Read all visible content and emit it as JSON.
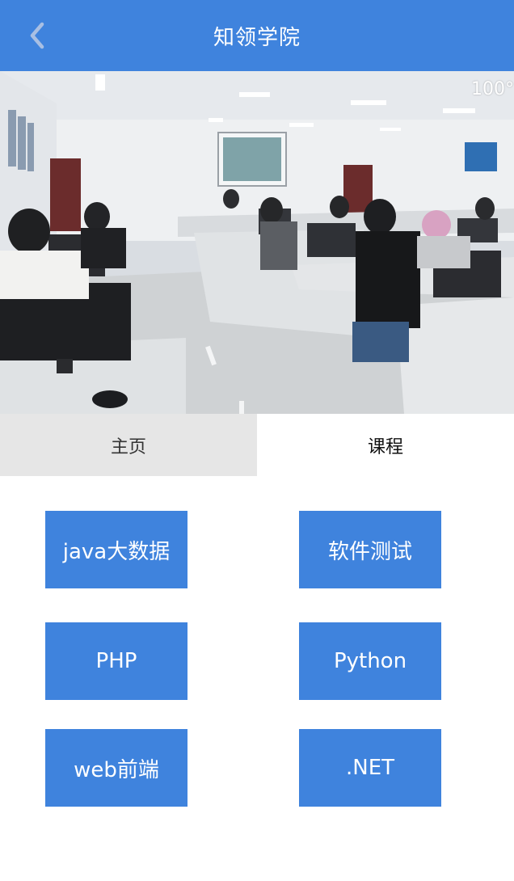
{
  "header": {
    "title": "知领学院",
    "back_icon": "chevron-left-icon"
  },
  "banner": {
    "overlay_text": "100°"
  },
  "tabs": [
    {
      "label": "主页",
      "active": true
    },
    {
      "label": "课程",
      "active": false
    }
  ],
  "courses": [
    {
      "label": "java大数据"
    },
    {
      "label": "软件测试"
    },
    {
      "label": "PHP"
    },
    {
      "label": "Python"
    },
    {
      "label": "web前端"
    },
    {
      "label": ".NET"
    }
  ],
  "colors": {
    "primary": "#3f83dd",
    "tab_active_bg": "#e6e6e6"
  }
}
